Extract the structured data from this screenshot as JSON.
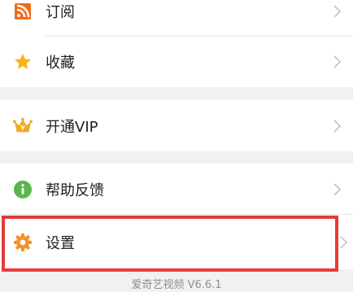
{
  "menu": {
    "subscribe": {
      "label": "订阅",
      "icon": "rss-icon"
    },
    "favorites": {
      "label": "收藏",
      "icon": "star-icon"
    },
    "vip": {
      "label": "开通VIP",
      "icon": "crown-icon"
    },
    "help": {
      "label": "帮助反馈",
      "icon": "info-icon"
    },
    "settings": {
      "label": "设置",
      "icon": "gear-icon"
    }
  },
  "footer": {
    "version_text": "爱奇艺视频 V6.6.1"
  },
  "colors": {
    "subscribe_icon": "#f46a16",
    "star_icon": "#f7b21b",
    "vip_icon": "#f4a91f",
    "help_icon": "#58b84a",
    "gear_icon": "#f3922a",
    "highlight_border": "#e83a3a",
    "chevron": "#c6c6c6",
    "section_gap": "#f1f1f1"
  }
}
